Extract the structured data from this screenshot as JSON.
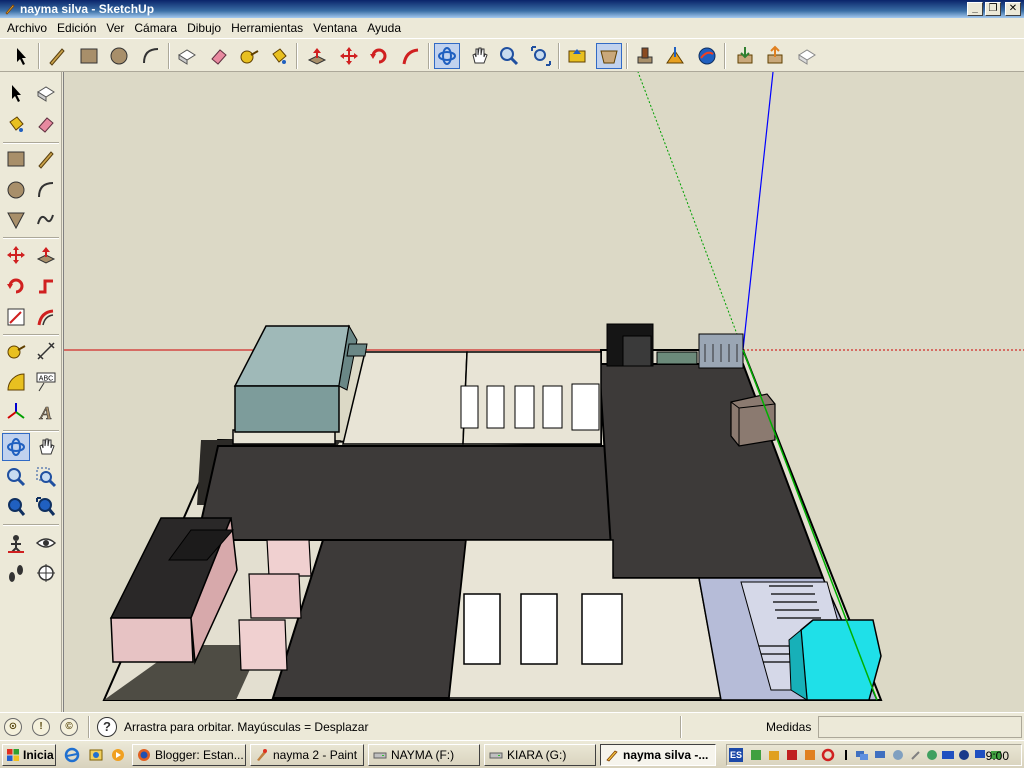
{
  "window": {
    "title": "nayma silva - SketchUp",
    "controls": [
      "_",
      "❐",
      "✕"
    ]
  },
  "menu": [
    "Archivo",
    "Edición",
    "Ver",
    "Cámara",
    "Dibujo",
    "Herramientas",
    "Ventana",
    "Ayuda"
  ],
  "status": {
    "hint": "Arrastra para orbitar. Mayúsculas = Desplazar",
    "measure_label": "Medidas",
    "measure_value": ""
  },
  "palette_labels": {
    "text_label": "ABC",
    "dimension_label": "A"
  },
  "taskbar": {
    "start_label": "Inicia",
    "tasks": [
      {
        "label": "Blogger: Estan..."
      },
      {
        "label": "nayma 2 - Paint"
      },
      {
        "label": "NAYMA (F:)"
      },
      {
        "label": "KIARA (G:)"
      },
      {
        "label": "nayma silva -..."
      }
    ],
    "lang": "ES",
    "clock": "9:00"
  },
  "colors": {
    "sky": "#dcd9c6",
    "asphalt": "#3b3838",
    "building": "#7d9c9b",
    "pink_box": "#e7c3c4",
    "cyan_box": "#1fe0e8",
    "pavement": "#e8e4d6",
    "sidewalk": "#b6bcd8",
    "axis_red": "#d00000",
    "axis_blue": "#0000ff",
    "axis_green": "#00b000"
  }
}
